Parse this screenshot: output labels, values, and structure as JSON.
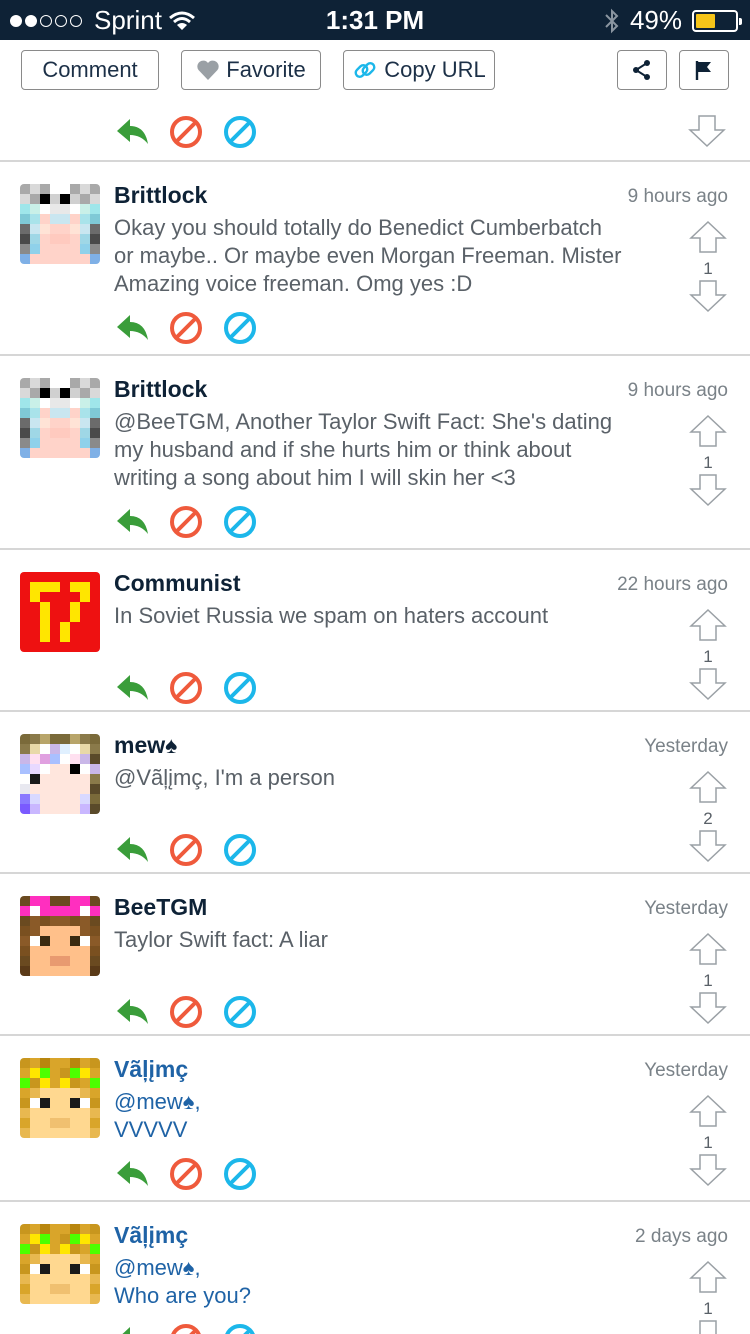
{
  "status_bar": {
    "carrier": "Sprint",
    "time": "1:31 PM",
    "battery": "49%",
    "battery_level": 0.49
  },
  "toolbar": {
    "comment_label": "Comment",
    "favorite_label": "Favorite",
    "copy_url_label": "Copy URL"
  },
  "comments": [
    {
      "author": "Brittlock",
      "time": "9 hours ago",
      "lines": [
        "Okay you should totally do Benedict Cumberbatch",
        "or maybe.. Or maybe even Morgan Freeman. Mister",
        "Amazing voice freeman. Omg yes :D"
      ],
      "votes": "1",
      "avatar": "brittlock",
      "blue": false
    },
    {
      "author": "Brittlock",
      "time": "9 hours ago",
      "lines": [
        "@BeeTGM, Another Taylor Swift Fact: She's dating",
        "my husband and if she hurts him or think about",
        "writing a song about him I will skin her <3"
      ],
      "votes": "1",
      "avatar": "brittlock",
      "blue": false
    },
    {
      "author": "Communist",
      "time": "22 hours ago",
      "lines": [
        "In Soviet Russia we spam on haters account"
      ],
      "votes": "1",
      "avatar": "communist",
      "blue": false
    },
    {
      "author": "mew♠",
      "time": "Yesterday",
      "lines": [
        "@Vãļįmç, I'm a person"
      ],
      "votes": "2",
      "avatar": "mew",
      "blue": false
    },
    {
      "author": "BeeTGM",
      "time": "Yesterday",
      "lines": [
        "Taylor Swift fact: A liar"
      ],
      "votes": "1",
      "avatar": "beetgm",
      "blue": false
    },
    {
      "author": "Vãļįmç",
      "time": "Yesterday",
      "lines": [
        "@mew♠,",
        "VVVVV"
      ],
      "votes": "1",
      "avatar": "valimc",
      "blue": true
    },
    {
      "author": "Vãļįmç",
      "time": "2 days ago",
      "lines": [
        "@mew♠,",
        "Who are you?"
      ],
      "votes": "1",
      "avatar": "valimc",
      "blue": true
    }
  ],
  "colors": {
    "reply": "#3a9d3a",
    "block": "#ef5a3c",
    "hide": "#1cb7ea",
    "header_bg": "#0e2236"
  }
}
